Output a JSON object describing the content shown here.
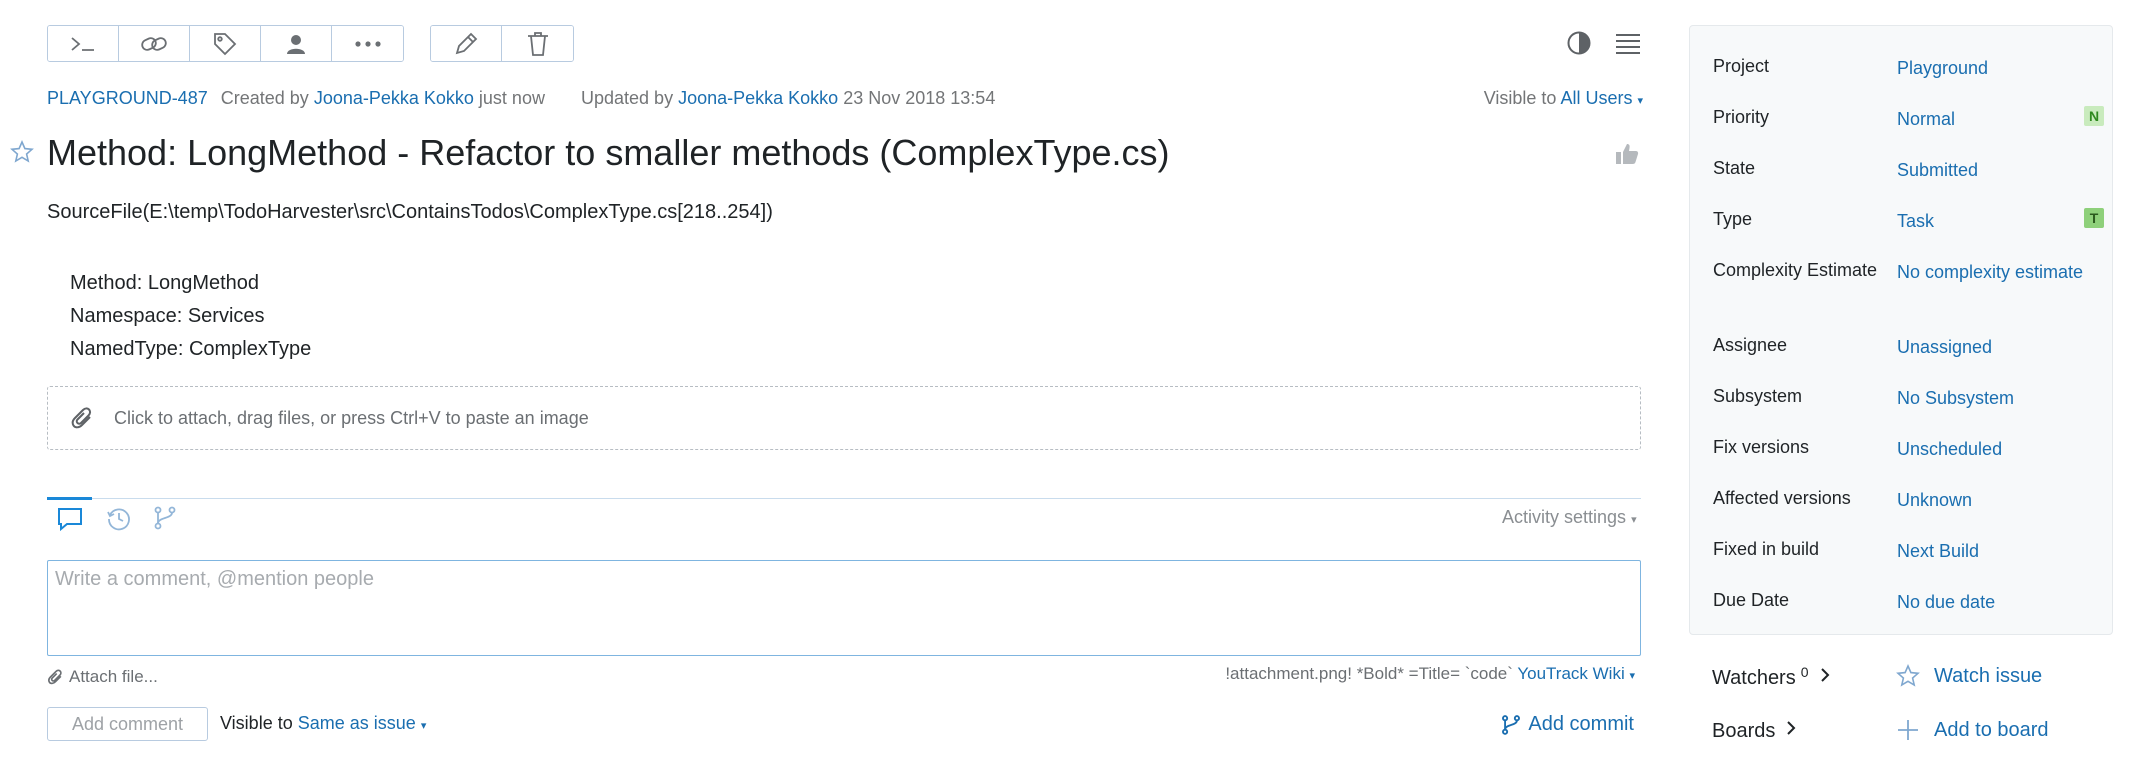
{
  "toolbar": {
    "group1": [
      {
        "icon": "command-icon"
      },
      {
        "icon": "link-icon"
      },
      {
        "icon": "tag-icon"
      },
      {
        "icon": "user-icon"
      },
      {
        "icon": "more-icon"
      }
    ],
    "group2": [
      {
        "icon": "pencil-icon"
      },
      {
        "icon": "trash-icon"
      }
    ]
  },
  "issue": {
    "id": "PLAYGROUND-487",
    "created_prefix": "Created by",
    "created_by": "Joona-Pekka Kokko",
    "created_when": "just now",
    "updated_prefix": "Updated by",
    "updated_by": "Joona-Pekka Kokko",
    "updated_when": "23 Nov 2018 13:54",
    "visible_prefix": "Visible to",
    "visible_value": "All Users",
    "title": "Method: LongMethod - Refactor to smaller methods (ComplexType.cs)",
    "description_first": "SourceFile(E:\\temp\\TodoHarvester\\src\\ContainsTodos\\ComplexType.cs[218..254])",
    "description_lines": [
      "Method: LongMethod",
      "Namespace: Services",
      "NamedType: ComplexType"
    ],
    "attach_hint": "Click to attach, drag files, or press Ctrl+V to paste an image"
  },
  "activity": {
    "settings_label": "Activity settings",
    "comment_placeholder": "Write a comment, @mention people",
    "attach_file": "Attach file...",
    "wiki_hint": "!attachment.png! *Bold* =Title= `code`",
    "wiki_link": "YouTrack Wiki",
    "add_comment": "Add comment",
    "visible_prefix": "Visible to",
    "visible_value": "Same as issue",
    "add_commit": "Add commit"
  },
  "fields": [
    {
      "name": "Project",
      "value": "Playground",
      "badge": ""
    },
    {
      "name": "Priority",
      "value": "Normal",
      "badge": "N",
      "badge_color": "#b7e2a6",
      "badge_text": "#2f8a1e"
    },
    {
      "name": "State",
      "value": "Submitted",
      "badge": ""
    },
    {
      "name": "Type",
      "value": "Task",
      "badge": "T",
      "badge_color": "#8ed07a",
      "badge_text": "#ffffff"
    },
    {
      "name": "Complexity Estimate",
      "value": "No complexity estimate",
      "badge": ""
    },
    {
      "name": "Assignee",
      "value": "Unassigned",
      "badge": ""
    },
    {
      "name": "Subsystem",
      "value": "No Subsystem",
      "badge": ""
    },
    {
      "name": "Fix versions",
      "value": "Unscheduled",
      "badge": ""
    },
    {
      "name": "Affected versions",
      "value": "Unknown",
      "badge": ""
    },
    {
      "name": "Fixed in build",
      "value": "Next Build",
      "badge": ""
    },
    {
      "name": "Due Date",
      "value": "No due date",
      "badge": ""
    }
  ],
  "sidebar_footer": {
    "watchers_label": "Watchers",
    "watchers_count": "0",
    "watch_issue": "Watch issue",
    "boards_label": "Boards",
    "add_to_board": "Add to board"
  },
  "colors": {
    "link": "#1a6eb0",
    "accent": "#1a88d8",
    "sidebar_bg": "#f7f9fa"
  }
}
